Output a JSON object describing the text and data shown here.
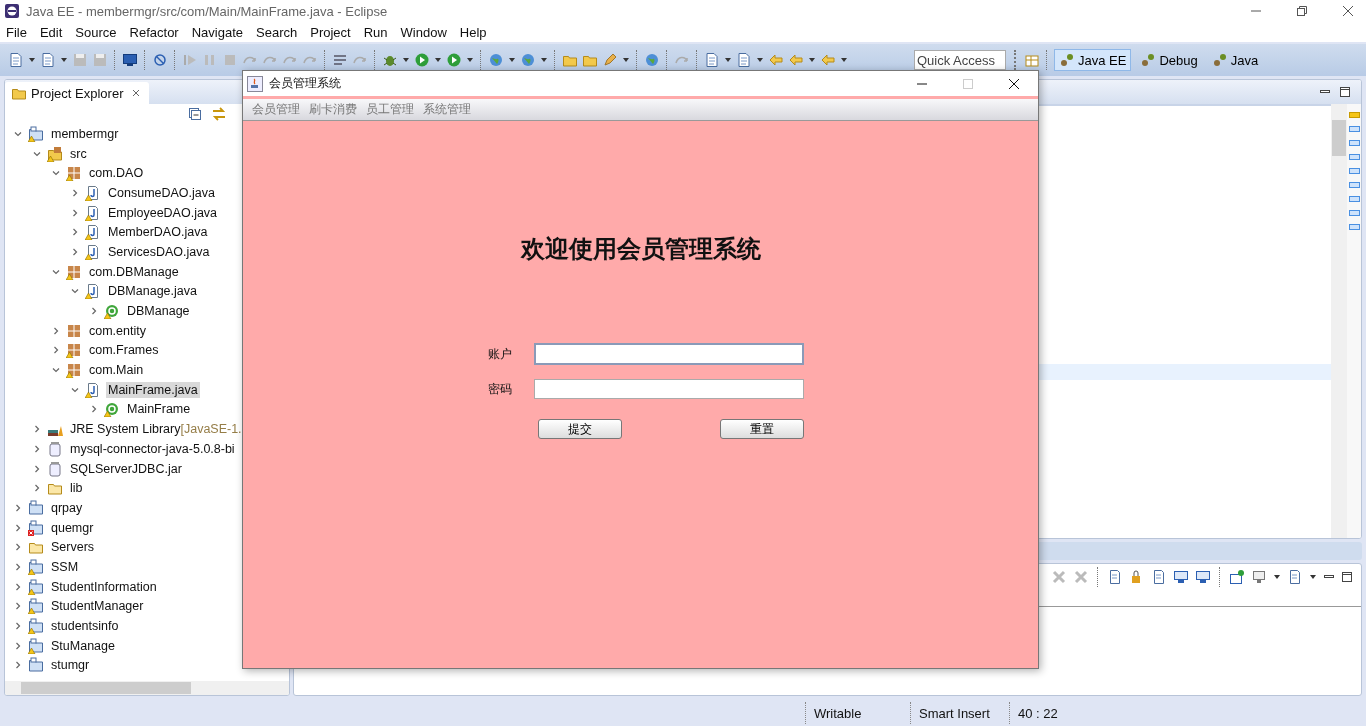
{
  "window": {
    "title": "Java EE - membermgr/src/com/Main/MainFrame.java - Eclipse"
  },
  "menu": [
    "File",
    "Edit",
    "Source",
    "Refactor",
    "Navigate",
    "Search",
    "Project",
    "Run",
    "Window",
    "Help"
  ],
  "quick_access": {
    "placeholder": "Quick Access"
  },
  "perspectives": [
    {
      "label": "Java EE",
      "selected": true
    },
    {
      "label": "Debug",
      "selected": false
    },
    {
      "label": "Java",
      "selected": false
    }
  ],
  "explorer": {
    "title": "Project Explorer",
    "tree": [
      {
        "label": "membermgr",
        "kind": "project",
        "warning": true,
        "error": false,
        "expanded": true,
        "selected": false,
        "children": [
          {
            "label": "src",
            "kind": "source-folder",
            "warning": true,
            "error": false,
            "expanded": true,
            "selected": false,
            "children": [
              {
                "label": "com.DAO",
                "kind": "package",
                "warning": true,
                "error": false,
                "expanded": true,
                "selected": false,
                "children": [
                  {
                    "label": "ConsumeDAO.java",
                    "kind": "java-file",
                    "warning": true,
                    "error": false,
                    "expanded": false,
                    "selected": false
                  },
                  {
                    "label": "EmployeeDAO.java",
                    "kind": "java-file",
                    "warning": true,
                    "error": false,
                    "expanded": false,
                    "selected": false
                  },
                  {
                    "label": "MemberDAO.java",
                    "kind": "java-file",
                    "warning": true,
                    "error": false,
                    "expanded": false,
                    "selected": false
                  },
                  {
                    "label": "ServicesDAO.java",
                    "kind": "java-file",
                    "warning": true,
                    "error": false,
                    "expanded": false,
                    "selected": false
                  }
                ]
              },
              {
                "label": "com.DBManage",
                "kind": "package",
                "warning": true,
                "error": false,
                "expanded": true,
                "selected": false,
                "children": [
                  {
                    "label": "DBManage.java",
                    "kind": "java-file",
                    "warning": true,
                    "error": false,
                    "expanded": true,
                    "selected": false,
                    "children": [
                      {
                        "label": "DBManage",
                        "kind": "class",
                        "warning": true,
                        "error": false,
                        "expanded": false,
                        "selected": false
                      }
                    ]
                  }
                ]
              },
              {
                "label": "com.entity",
                "kind": "package",
                "warning": false,
                "error": false,
                "expanded": false,
                "selected": false
              },
              {
                "label": "com.Frames",
                "kind": "package",
                "warning": true,
                "error": false,
                "expanded": false,
                "selected": false
              },
              {
                "label": "com.Main",
                "kind": "package",
                "warning": true,
                "error": false,
                "expanded": true,
                "selected": false,
                "children": [
                  {
                    "label": "MainFrame.java",
                    "kind": "java-file",
                    "warning": true,
                    "error": false,
                    "expanded": true,
                    "selected": true,
                    "children": [
                      {
                        "label": "MainFrame",
                        "kind": "class",
                        "warning": true,
                        "error": false,
                        "expanded": false,
                        "selected": false
                      }
                    ]
                  }
                ]
              }
            ]
          },
          {
            "label": "JRE System Library",
            "detail": "[JavaSE-1.",
            "kind": "library",
            "warning": false,
            "error": false,
            "expanded": false,
            "selected": false
          },
          {
            "label": "mysql-connector-java-5.0.8-bi",
            "kind": "jar",
            "warning": false,
            "error": false,
            "expanded": false,
            "selected": false
          },
          {
            "label": "SQLServerJDBC.jar",
            "kind": "jar",
            "warning": false,
            "error": false,
            "expanded": false,
            "selected": false
          },
          {
            "label": "lib",
            "kind": "folder",
            "warning": false,
            "error": false,
            "expanded": false,
            "selected": false
          }
        ]
      },
      {
        "label": "qrpay",
        "kind": "project",
        "warning": false,
        "error": false,
        "expanded": false,
        "selected": false
      },
      {
        "label": "quemgr",
        "kind": "project",
        "warning": false,
        "error": true,
        "expanded": false,
        "selected": false
      },
      {
        "label": "Servers",
        "kind": "folder",
        "warning": false,
        "error": false,
        "expanded": false,
        "selected": false
      },
      {
        "label": "SSM",
        "kind": "project",
        "warning": true,
        "error": false,
        "expanded": false,
        "selected": false
      },
      {
        "label": "StudentInformation",
        "kind": "project",
        "warning": true,
        "error": false,
        "expanded": false,
        "selected": false
      },
      {
        "label": "StudentManager",
        "kind": "project",
        "warning": true,
        "error": false,
        "expanded": false,
        "selected": false
      },
      {
        "label": "studentsinfo",
        "kind": "project",
        "warning": true,
        "error": false,
        "expanded": false,
        "selected": false
      },
      {
        "label": "StuManage",
        "kind": "project",
        "warning": true,
        "error": false,
        "expanded": false,
        "selected": false
      },
      {
        "label": "stumgr",
        "kind": "project",
        "warning": false,
        "error": false,
        "expanded": false,
        "selected": false
      }
    ]
  },
  "status_bar": [
    "Writable",
    "Smart Insert",
    "40 : 22"
  ],
  "app_window": {
    "title": "会员管理系统",
    "menu": [
      "会员管理",
      "刷卡消费",
      "员工管理",
      "系统管理"
    ],
    "heading": "欢迎使用会员管理系统",
    "fields": [
      {
        "label": "账户",
        "focused": true
      },
      {
        "label": "密码",
        "focused": false
      }
    ],
    "buttons": [
      "提交",
      "重置"
    ]
  }
}
